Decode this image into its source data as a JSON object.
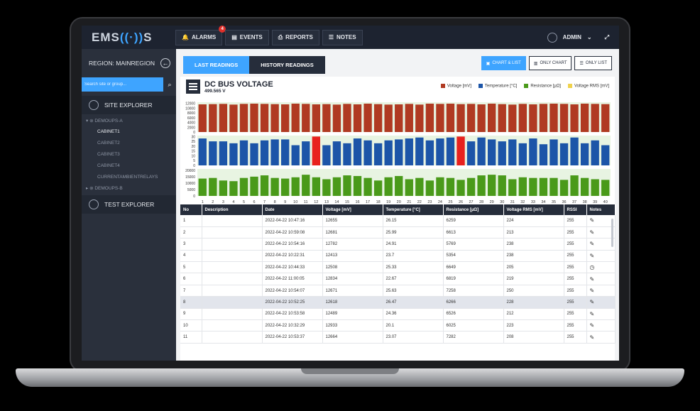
{
  "app": {
    "logo_prefix": "EMS",
    "logo_suffix": "S"
  },
  "nav": [
    {
      "label": "ALARMS",
      "icon": "bell-icon",
      "glyph": "🔔",
      "badge": "4"
    },
    {
      "label": "EVENTS",
      "icon": "events-icon",
      "glyph": "▤"
    },
    {
      "label": "REPORTS",
      "icon": "reports-icon",
      "glyph": "⎙"
    },
    {
      "label": "NOTES",
      "icon": "notes-icon",
      "glyph": "☰"
    }
  ],
  "user": {
    "name": "ADMIN",
    "chevron": "⌄",
    "fullscreen": "⤢"
  },
  "sidebar": {
    "region": "REGION: MAINREGION",
    "back_glyph": "←",
    "search_placeholder": "Search site or group...",
    "search_glyph": "⌕",
    "site_explorer": "SITE EXPLORER",
    "group_a": "DEMOUPS-A",
    "items": [
      "CABINET1",
      "CABINET2",
      "CABINET3",
      "CABINET4",
      "CURRENTAMBIENTRELAYS"
    ],
    "group_b": "DEMOUPS-B",
    "test_explorer": "TEST EXPLORER"
  },
  "tabs": {
    "last": "LAST READINGS",
    "history": "HISTORY READINGS"
  },
  "views": {
    "chart_list": "CHART & LIST",
    "only_chart": "ONLY CHART",
    "only_list": "ONLY LIST"
  },
  "chart_header": {
    "title": "DC BUS VOLTAGE",
    "subtitle": "499.565 V"
  },
  "legend": [
    {
      "label": "Voltage [mV]",
      "color": "#b03a22"
    },
    {
      "label": "Temperature [°C]",
      "color": "#1c55a8"
    },
    {
      "label": "Resistance [µΩ]",
      "color": "#4a9a1a"
    },
    {
      "label": "Voltage RMS [mV]",
      "color": "#f0d24a"
    }
  ],
  "chart_data": {
    "type": "bar",
    "categories": [
      "1",
      "2",
      "3",
      "4",
      "5",
      "6",
      "7",
      "8",
      "9",
      "10",
      "11",
      "12",
      "13",
      "14",
      "15",
      "16",
      "17",
      "18",
      "19",
      "20",
      "21",
      "22",
      "23",
      "24",
      "25",
      "26",
      "27",
      "28",
      "29",
      "30",
      "31",
      "32",
      "33",
      "34",
      "35",
      "36",
      "37",
      "38",
      "39",
      "40"
    ],
    "series": [
      {
        "name": "Voltage [mV]",
        "yticks": [
          0,
          2000,
          4000,
          6000,
          8000,
          10000,
          12000
        ],
        "ylim": [
          0,
          12500
        ],
        "color": "#b03a22",
        "values": [
          11600,
          11700,
          11800,
          11500,
          11800,
          11900,
          11800,
          11700,
          11600,
          11900,
          11800,
          11600,
          11700,
          11500,
          11800,
          11600,
          11900,
          11700,
          11500,
          11600,
          11800,
          11500,
          11900,
          11800,
          11900,
          11700,
          11800,
          11600,
          11900,
          11700,
          11500,
          11800,
          11600,
          11800,
          11900,
          11800,
          11600,
          11900,
          11800,
          11700
        ]
      },
      {
        "name": "Temperature [°C]",
        "yticks": [
          0,
          5,
          10,
          15,
          20,
          25,
          30
        ],
        "ylim": [
          0,
          31
        ],
        "color": "#1c55a8",
        "highlight_color": "#e8211e",
        "highlight_values": [
          30,
          30
        ],
        "highlight_at": [
          "12",
          "26"
        ],
        "values": [
          28,
          25,
          25,
          23,
          26,
          23,
          26,
          27,
          27,
          21,
          25,
          30,
          21,
          25,
          23,
          28,
          26,
          23,
          26,
          27,
          28,
          29,
          26,
          28,
          29,
          30,
          25,
          29,
          27,
          25,
          27,
          23,
          28,
          22,
          27,
          23,
          29,
          23,
          26,
          21
        ]
      },
      {
        "name": "Resistance [µΩ]",
        "yticks": [
          0,
          5000,
          10000,
          15000,
          20000
        ],
        "ylim": [
          0,
          21000
        ],
        "color": "#4a9a1a",
        "values": [
          13500,
          14000,
          12000,
          11500,
          14000,
          15000,
          16000,
          14000,
          13500,
          14500,
          16500,
          14500,
          13000,
          14500,
          16000,
          15500,
          14000,
          12000,
          14500,
          15500,
          13000,
          14000,
          12000,
          14500,
          14000,
          12500,
          14000,
          16000,
          16500,
          16000,
          13000,
          14500,
          14000,
          14000,
          14000,
          12500,
          16000,
          14000,
          13000,
          12500
        ]
      }
    ]
  },
  "table": {
    "columns": [
      "No",
      "Description",
      "Date",
      "Voltage [mV]",
      "Temperature [°C]",
      "Resistance [µΩ]",
      "Voltage RMS [mV]",
      "RSSI",
      "Notes"
    ],
    "rows": [
      [
        "1",
        "",
        "2022-04-22 10:47:16",
        "12655",
        "26.15",
        "6259",
        "224",
        "255",
        "✎"
      ],
      [
        "2",
        "",
        "2022-04-22 10:59:08",
        "12681",
        "25.99",
        "6613",
        "213",
        "255",
        "✎"
      ],
      [
        "3",
        "",
        "2022-04-22 10:54:16",
        "12782",
        "24.91",
        "5769",
        "238",
        "255",
        "✎"
      ],
      [
        "4",
        "",
        "2022-04-22 10:22:31",
        "12413",
        "23.7",
        "5354",
        "238",
        "255",
        "✎"
      ],
      [
        "5",
        "",
        "2022-04-22 10:44:33",
        "12508",
        "25.33",
        "6649",
        "205",
        "255",
        "◷"
      ],
      [
        "6",
        "",
        "2022-04-22 11:00:05",
        "12834",
        "22.67",
        "6819",
        "219",
        "255",
        "✎"
      ],
      [
        "7",
        "",
        "2022-04-22 10:54:07",
        "12671",
        "25.63",
        "7258",
        "250",
        "255",
        "✎"
      ],
      [
        "8",
        "",
        "2022-04-22 10:52:25",
        "12618",
        "26.47",
        "6266",
        "228",
        "255",
        "✎"
      ],
      [
        "9",
        "",
        "2022-04-22 10:53:58",
        "12489",
        "24.36",
        "6526",
        "212",
        "255",
        "✎"
      ],
      [
        "10",
        "",
        "2022-04-22 10:32:29",
        "12933",
        "20.1",
        "6025",
        "223",
        "255",
        "✎"
      ],
      [
        "11",
        "",
        "2022-04-22 10:53:37",
        "12664",
        "23.07",
        "7282",
        "208",
        "255",
        "✎"
      ]
    ],
    "highlighted_row": "8"
  }
}
